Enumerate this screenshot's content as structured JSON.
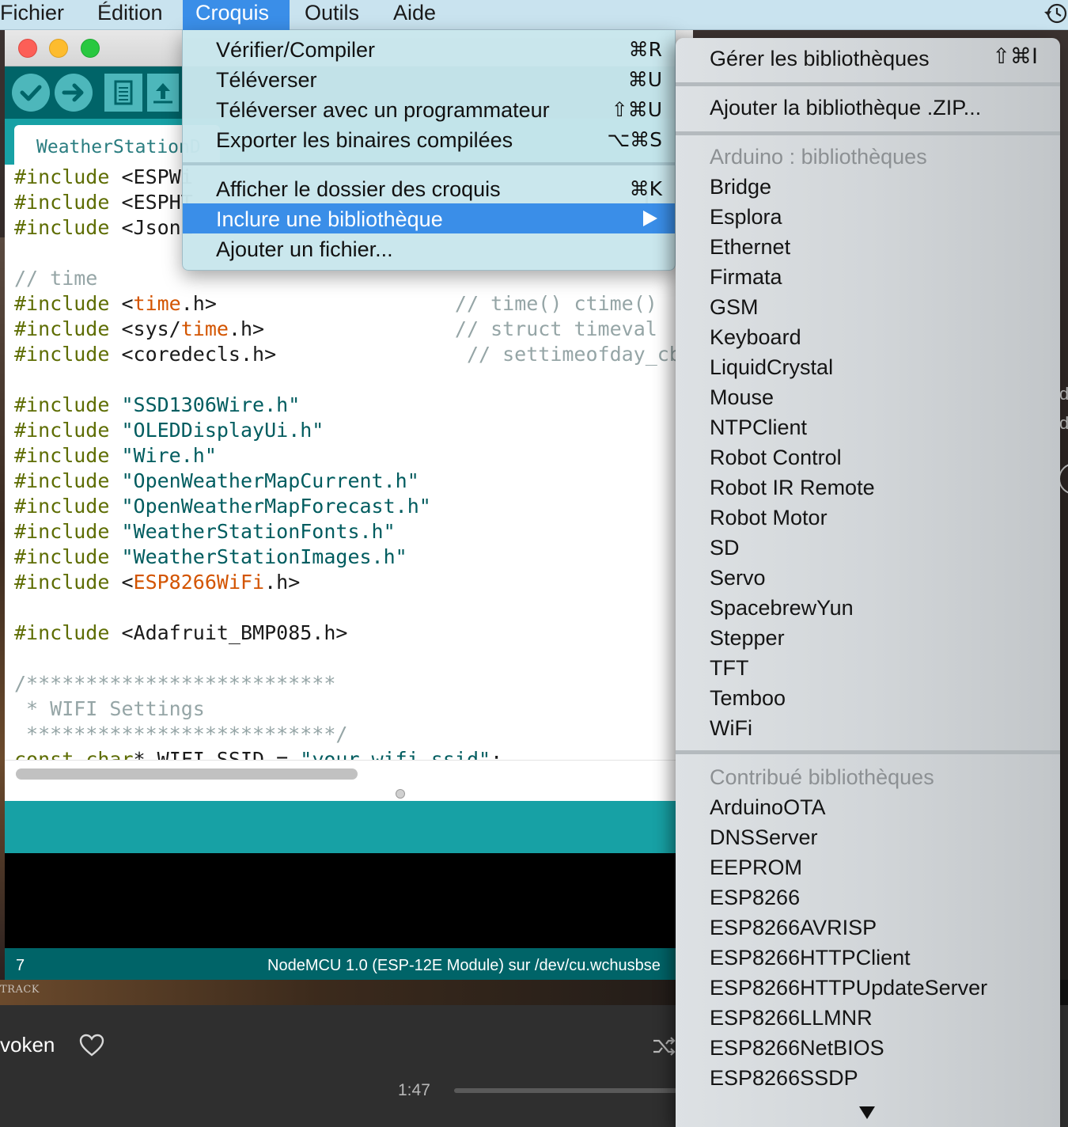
{
  "menubar": {
    "items": [
      {
        "label": "Fichier"
      },
      {
        "label": "Édition"
      },
      {
        "label": "Croquis"
      },
      {
        "label": "Outils"
      },
      {
        "label": "Aide"
      }
    ]
  },
  "window": {
    "tab_label": "WeatherStationD"
  },
  "code": {
    "lines": [
      [
        {
          "t": "#include",
          "c": "kw"
        },
        {
          "t": " <ESPWi"
        }
      ],
      [
        {
          "t": "#include",
          "c": "kw"
        },
        {
          "t": " <ESPHT"
        }
      ],
      [
        {
          "t": "#include",
          "c": "kw"
        },
        {
          "t": " <JsonL"
        }
      ],
      [],
      [
        {
          "t": "// time",
          "c": "cm"
        }
      ],
      [
        {
          "t": "#include",
          "c": "kw"
        },
        {
          "t": " <"
        },
        {
          "t": "time",
          "c": "lib"
        },
        {
          "t": ".h>"
        },
        {
          "t": "                    // time() ctime()",
          "c": "cm"
        }
      ],
      [
        {
          "t": "#include",
          "c": "kw"
        },
        {
          "t": " <sys/"
        },
        {
          "t": "time",
          "c": "lib"
        },
        {
          "t": ".h>"
        },
        {
          "t": "                // struct timeval",
          "c": "cm"
        }
      ],
      [
        {
          "t": "#include",
          "c": "kw"
        },
        {
          "t": " <coredecls.h>"
        },
        {
          "t": "                // settimeofday_cb()",
          "c": "cm"
        }
      ],
      [],
      [
        {
          "t": "#include",
          "c": "kw"
        },
        {
          "t": " \"SSD1306Wire.h\"",
          "c": "str"
        }
      ],
      [
        {
          "t": "#include",
          "c": "kw"
        },
        {
          "t": " \"OLEDDisplayUi.h\"",
          "c": "str"
        }
      ],
      [
        {
          "t": "#include",
          "c": "kw"
        },
        {
          "t": " \"Wire.h\"",
          "c": "str"
        }
      ],
      [
        {
          "t": "#include",
          "c": "kw"
        },
        {
          "t": " \"OpenWeatherMapCurrent.h\"",
          "c": "str"
        }
      ],
      [
        {
          "t": "#include",
          "c": "kw"
        },
        {
          "t": " \"OpenWeatherMapForecast.h\"",
          "c": "str"
        }
      ],
      [
        {
          "t": "#include",
          "c": "kw"
        },
        {
          "t": " \"WeatherStationFonts.h\"",
          "c": "str"
        }
      ],
      [
        {
          "t": "#include",
          "c": "kw"
        },
        {
          "t": " \"WeatherStationImages.h\"",
          "c": "str"
        }
      ],
      [
        {
          "t": "#include",
          "c": "kw"
        },
        {
          "t": " <"
        },
        {
          "t": "ESP8266WiFi",
          "c": "lib"
        },
        {
          "t": ".h>"
        }
      ],
      [],
      [
        {
          "t": "#include",
          "c": "kw"
        },
        {
          "t": " <Adafruit_BMP085.h>"
        }
      ],
      [],
      [
        {
          "t": "/**************************",
          "c": "cm"
        }
      ],
      [
        {
          "t": " * WIFI Settings",
          "c": "cm"
        }
      ],
      [
        {
          "t": " **************************/",
          "c": "cm"
        }
      ],
      [
        {
          "t": "const",
          "c": "kw"
        },
        {
          "t": " "
        },
        {
          "t": "char",
          "c": "kw"
        },
        {
          "t": "* WIFI_SSID = "
        },
        {
          "t": "\"your_wifi_ssid\"",
          "c": "str"
        },
        {
          "t": ";"
        }
      ]
    ]
  },
  "status": {
    "line_number": "7",
    "board": "NodeMCU 1.0 (ESP-12E Module) sur /dev/cu.wchusbse"
  },
  "croquis_menu": {
    "items": [
      {
        "label": "Vérifier/Compiler",
        "shortcut": "⌘R"
      },
      {
        "label": "Téléverser",
        "shortcut": "⌘U"
      },
      {
        "label": "Téléverser avec un programmateur",
        "shortcut": "⇧⌘U"
      },
      {
        "label": "Exporter les binaires compilées",
        "shortcut": "⌥⌘S"
      },
      {
        "label": "Afficher le dossier des croquis",
        "shortcut": "⌘K"
      },
      {
        "label": "Inclure une bibliothèque",
        "shortcut": ""
      },
      {
        "label": "Ajouter un fichier...",
        "shortcut": ""
      }
    ]
  },
  "library_menu": {
    "manage_label": "Gérer les bibliothèques",
    "manage_shortcut": "⇧⌘I",
    "add_zip_label": "Ajouter la bibliothèque .ZIP...",
    "arduino_header": "Arduino :  bibliothèques",
    "arduino_libs": [
      "Bridge",
      "Esplora",
      "Ethernet",
      "Firmata",
      "GSM",
      "Keyboard",
      "LiquidCrystal",
      "Mouse",
      "NTPClient",
      "Robot Control",
      "Robot IR Remote",
      "Robot Motor",
      "SD",
      "Servo",
      "SpacebrewYun",
      "Stepper",
      "TFT",
      "Temboo",
      "WiFi"
    ],
    "contrib_header": "Contribué bibliothèques",
    "contrib_libs": [
      "ArduinoOTA",
      "DNSServer",
      "EEPROM",
      "ESP8266",
      "ESP8266AVRISP",
      "ESP8266HTTPClient",
      "ESP8266HTTPUpdateServer",
      "ESP8266LLMNR",
      "ESP8266NetBIOS",
      "ESP8266SSDP"
    ]
  },
  "player": {
    "track_label": "TRACK",
    "song": "voken",
    "elapsed": "1:47",
    "progress": 0.0
  },
  "desktop": {
    "right_edge_a": "d",
    "right_edge_b": "d"
  },
  "colors": {
    "menubar_bg": "#c9e3ef",
    "highlight": "#3a8ee8",
    "arduino_teal": "#17a1a5",
    "arduino_dark": "#006468"
  }
}
